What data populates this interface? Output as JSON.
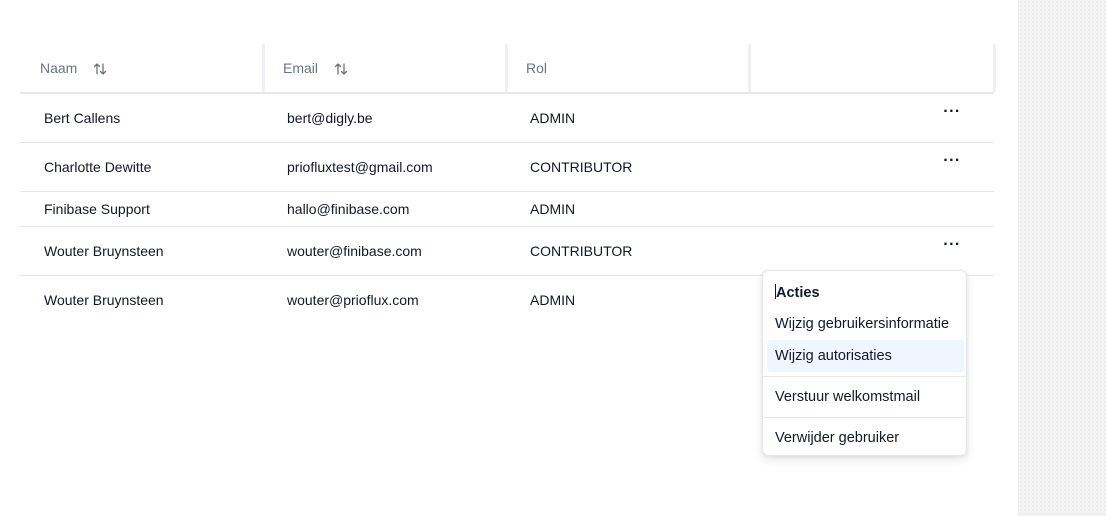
{
  "table": {
    "columns": [
      {
        "label": "Naam",
        "sortable": true,
        "icon": "sort-icon"
      },
      {
        "label": "Email",
        "sortable": true,
        "icon": "sort-icon"
      },
      {
        "label": "Rol",
        "sortable": false
      },
      {
        "label": "",
        "sortable": false
      }
    ],
    "rows": [
      {
        "name": "Bert Callens",
        "email": "bert@digly.be",
        "role": "ADMIN",
        "has_actions": true
      },
      {
        "name": "Charlotte Dewitte",
        "email": "priofluxtest@gmail.com",
        "role": "CONTRIBUTOR",
        "has_actions": true
      },
      {
        "name": "Finibase Support",
        "email": "hallo@finibase.com",
        "role": "ADMIN",
        "has_actions": false
      },
      {
        "name": "Wouter Bruynsteen",
        "email": "wouter@finibase.com",
        "role": "CONTRIBUTOR",
        "has_actions": true
      },
      {
        "name": "Wouter Bruynsteen",
        "email": "wouter@prioflux.com",
        "role": "ADMIN",
        "has_actions": false
      }
    ],
    "actions_glyph": "···"
  },
  "menu": {
    "title": "Acties",
    "items": [
      {
        "label": "Wijzig gebruikersinformatie",
        "active": false
      },
      {
        "label": "Wijzig autorisaties",
        "active": true
      },
      {
        "label": "Verstuur welkomstmail",
        "active": false
      },
      {
        "label": "Verwijder gebruiker",
        "active": false
      }
    ]
  },
  "colors": {
    "header_text": "#6b7280",
    "border": "#e5e7eb",
    "menu_active_bg": "#eff6ff",
    "side_panel_bg": "#f4f4f4"
  }
}
